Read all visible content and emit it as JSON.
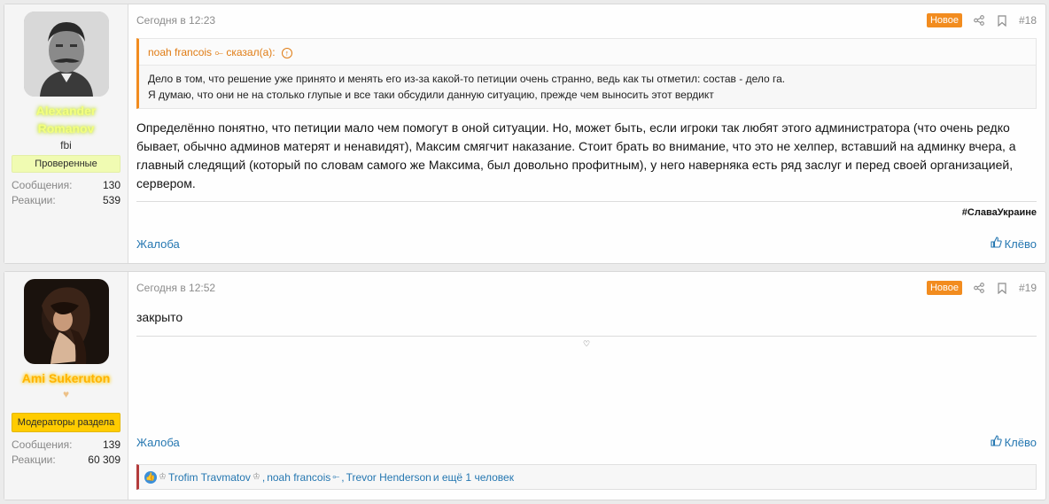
{
  "posts": [
    {
      "author": {
        "name": "Alexander Romanov",
        "title": "fbi",
        "banner": "Проверенные",
        "messages_label": "Сообщения:",
        "messages": "130",
        "reactions_label": "Реакции:",
        "reactions": "539",
        "avatar_icon": "portrait-man-mustache"
      },
      "date": "Сегодня в 12:23",
      "new_label": "Новое",
      "number": "#18",
      "quote": {
        "author": "noah francois",
        "said": "сказал(а):",
        "lines": [
          "Дело в том, что решение уже принято и менять его из-за какой-то петиции очень странно, ведь как ты отметил: состав - дело га.",
          "Я думаю, что они не на столько глупые и все таки обсудили данную ситуацию, прежде чем выносить этот вердикт"
        ]
      },
      "body": "Определённо понятно, что петиции мало чем помогут в оной ситуации. Но, может быть, если игроки так любят этого администратора (что очень редко бывает, обычно админов матерят и ненавидят), Максим смягчит наказание. Стоит брать во внимание, что это не хелпер, вставший на админку вчера, а главный следящий (который по словам самого же Максима, был довольно профитным), у него наверняка есть ряд заслуг и перед своей организацией, сервером.",
      "signature": "#СлаваУкраине",
      "report_label": "Жалоба",
      "like_label": "Клёво"
    },
    {
      "author": {
        "name": "Ami Sukeruton",
        "heart": "♥",
        "banner": "Модераторы раздела",
        "messages_label": "Сообщения:",
        "messages": "139",
        "reactions_label": "Реакции:",
        "reactions": "60 309",
        "avatar_icon": "portrait-dark-hair"
      },
      "date": "Сегодня в 12:52",
      "new_label": "Новое",
      "number": "#19",
      "body": "закрыто",
      "signature": "♡",
      "report_label": "Жалоба",
      "like_label": "Клёво",
      "reactions_line": {
        "user1": "Trofim Travmatov",
        "sep1": ",",
        "user2": "noah francois",
        "sep2": ",",
        "user3": "Trevor Henderson",
        "rest": "и ещё 1 человек"
      }
    }
  ],
  "colors": {
    "accent": "#f28c1f",
    "link": "#2577b1",
    "moderator": "#ffcc00"
  }
}
